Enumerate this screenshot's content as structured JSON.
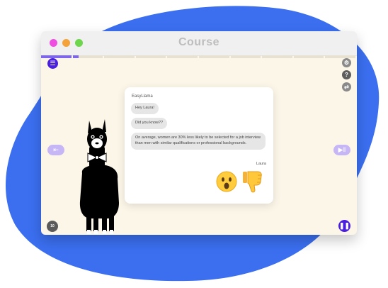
{
  "window": {
    "title": "Course"
  },
  "colors": {
    "blob": "#3b6ff0",
    "window_bg": "#fcf6e9",
    "traffic_red": "#ef4fe0",
    "traffic_yellow": "#f4a23a",
    "traffic_green": "#6ed64c",
    "accent_purple": "#4b1fe0",
    "nav_lavender": "#c7b6f6",
    "progress_fill": "#7d66e8"
  },
  "progress": {
    "segments": 10,
    "active_fraction": 0.12
  },
  "controls": {
    "menu_icon": "hamburger-icon",
    "settings_icon": "gear-icon",
    "help_label": "?",
    "translate_icon": "translate-icon",
    "prev_icon": "previous-arrow-icon",
    "next_icon": "next-arrow-icon",
    "replay_label": "10",
    "pause_icon": "pause-icon"
  },
  "chat": {
    "sender": "EasyLlama",
    "messages": [
      "Hey Laura!",
      "Did you know??",
      "On average, women are 30% less likely to be selected for a job interview than men with similar qualifications or professional backgrounds."
    ],
    "reply_name": "Laura",
    "reply_options": [
      {
        "icon": "surprised-face-icon",
        "emoji": "😮"
      },
      {
        "icon": "thumbs-down-icon",
        "emoji": "👎"
      }
    ]
  }
}
